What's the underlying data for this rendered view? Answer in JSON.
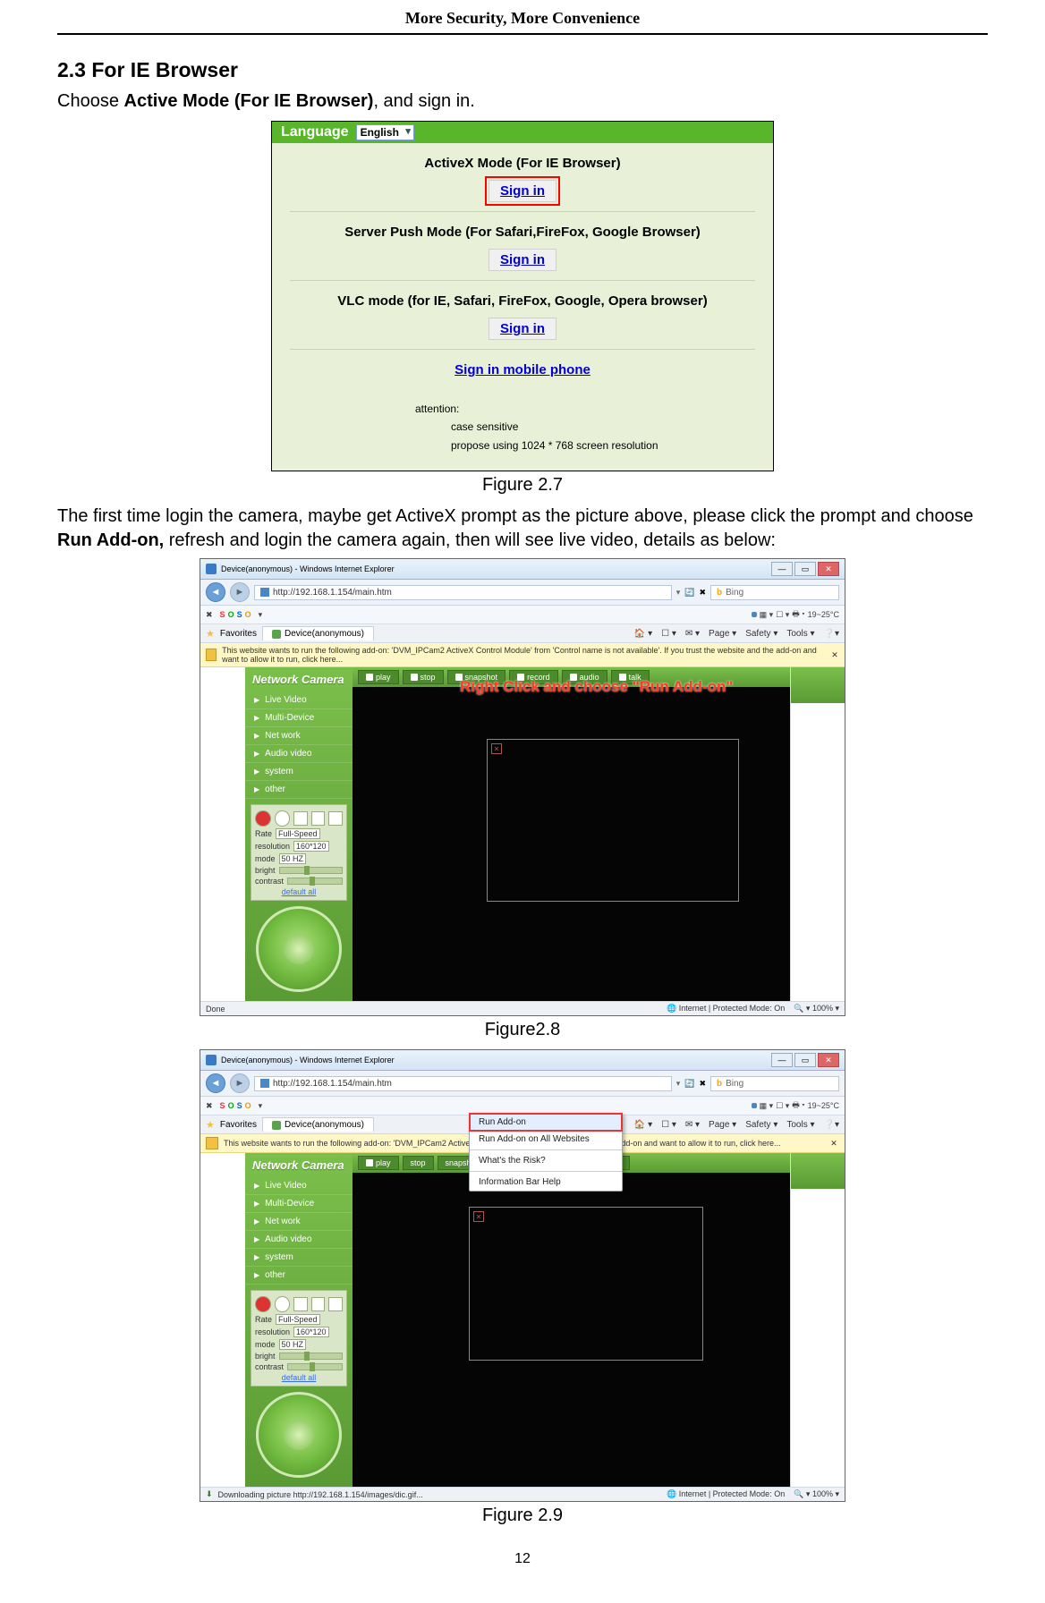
{
  "doc": {
    "running_head": "More Security, More Convenience",
    "section_title": "2.3 For IE Browser",
    "intro_pre": "Choose ",
    "intro_bold": "Active Mode (For IE Browser)",
    "intro_post": ", and sign in.",
    "fig27_caption": "Figure 2.7",
    "para2_a": "The first time login the camera, maybe get ActiveX prompt as the picture above, please click the prompt and choose ",
    "para2_bold": "Run Add-on,",
    "para2_b": " refresh and login the camera again, then will see live video, details as below",
    "para2_colon": ":",
    "fig28_caption": "Figure2.8",
    "fig29_caption": "Figure 2.9",
    "page_number": "12"
  },
  "login": {
    "language_label": "Language",
    "language_value": "English",
    "mode1": "ActiveX Mode (For IE Browser)",
    "mode2": "Server Push Mode (For Safari,FireFox, Google Browser)",
    "mode3": "VLC mode (for IE, Safari, FireFox, Google, Opera browser)",
    "signin": "Sign in",
    "signin_mobile": "Sign in mobile phone",
    "attention_label": "attention:",
    "attention_1": "case sensitive",
    "attention_2": "propose using 1024 * 768 screen resolution"
  },
  "ie": {
    "title": "Device(anonymous) - Windows Internet Explorer",
    "url": "http://192.168.1.154/main.htm",
    "search_placeholder": "Bing",
    "fav_label": "Favorites",
    "tab_label": "Device(anonymous)",
    "temp": "19~25°C",
    "tools": [
      "Page ▾",
      "Safety ▾",
      "Tools ▾"
    ],
    "yellow_msg": "This website wants to run the following add-on: 'DVM_IPCam2 ActiveX Control Module' from 'Control name is not available'. If you trust the website and the add-on and want to allow it to run, click here...",
    "yellow_msg2": "This website wants to run the following add-on: 'DVM_IPCam2 ActiveX Control Module' from 'Con                                                   site and the add-on and want to allow it to run, click here...",
    "status_done": "Done",
    "status_downloading": "Downloading picture http://192.168.1.154/images/dic.gif...",
    "status_mode": "Internet | Protected Mode: On",
    "zoom": "100%"
  },
  "cam": {
    "brand": "Network Camera",
    "side_items": [
      "Live Video",
      "Multi-Device",
      "Net work",
      "Audio video",
      "system",
      "other"
    ],
    "buttons": [
      "play",
      "stop",
      "snapshot",
      "record",
      "audio",
      "talk"
    ],
    "rate_label": "Rate",
    "rate_value": "Full-Speed",
    "resolution_label": "resolution",
    "resolution_value": "160*120",
    "mode_label": "mode",
    "mode_value": "50 HZ",
    "bright_label": "bright",
    "contrast_label": "contrast",
    "default_label": "default all",
    "overlay_text": "Right Click and choose \"Run Add-on\""
  },
  "ctx": {
    "item1": "Run Add-on",
    "item2": "Run Add-on on All Websites",
    "item3": "What's the Risk?",
    "item4": "Information Bar Help"
  }
}
